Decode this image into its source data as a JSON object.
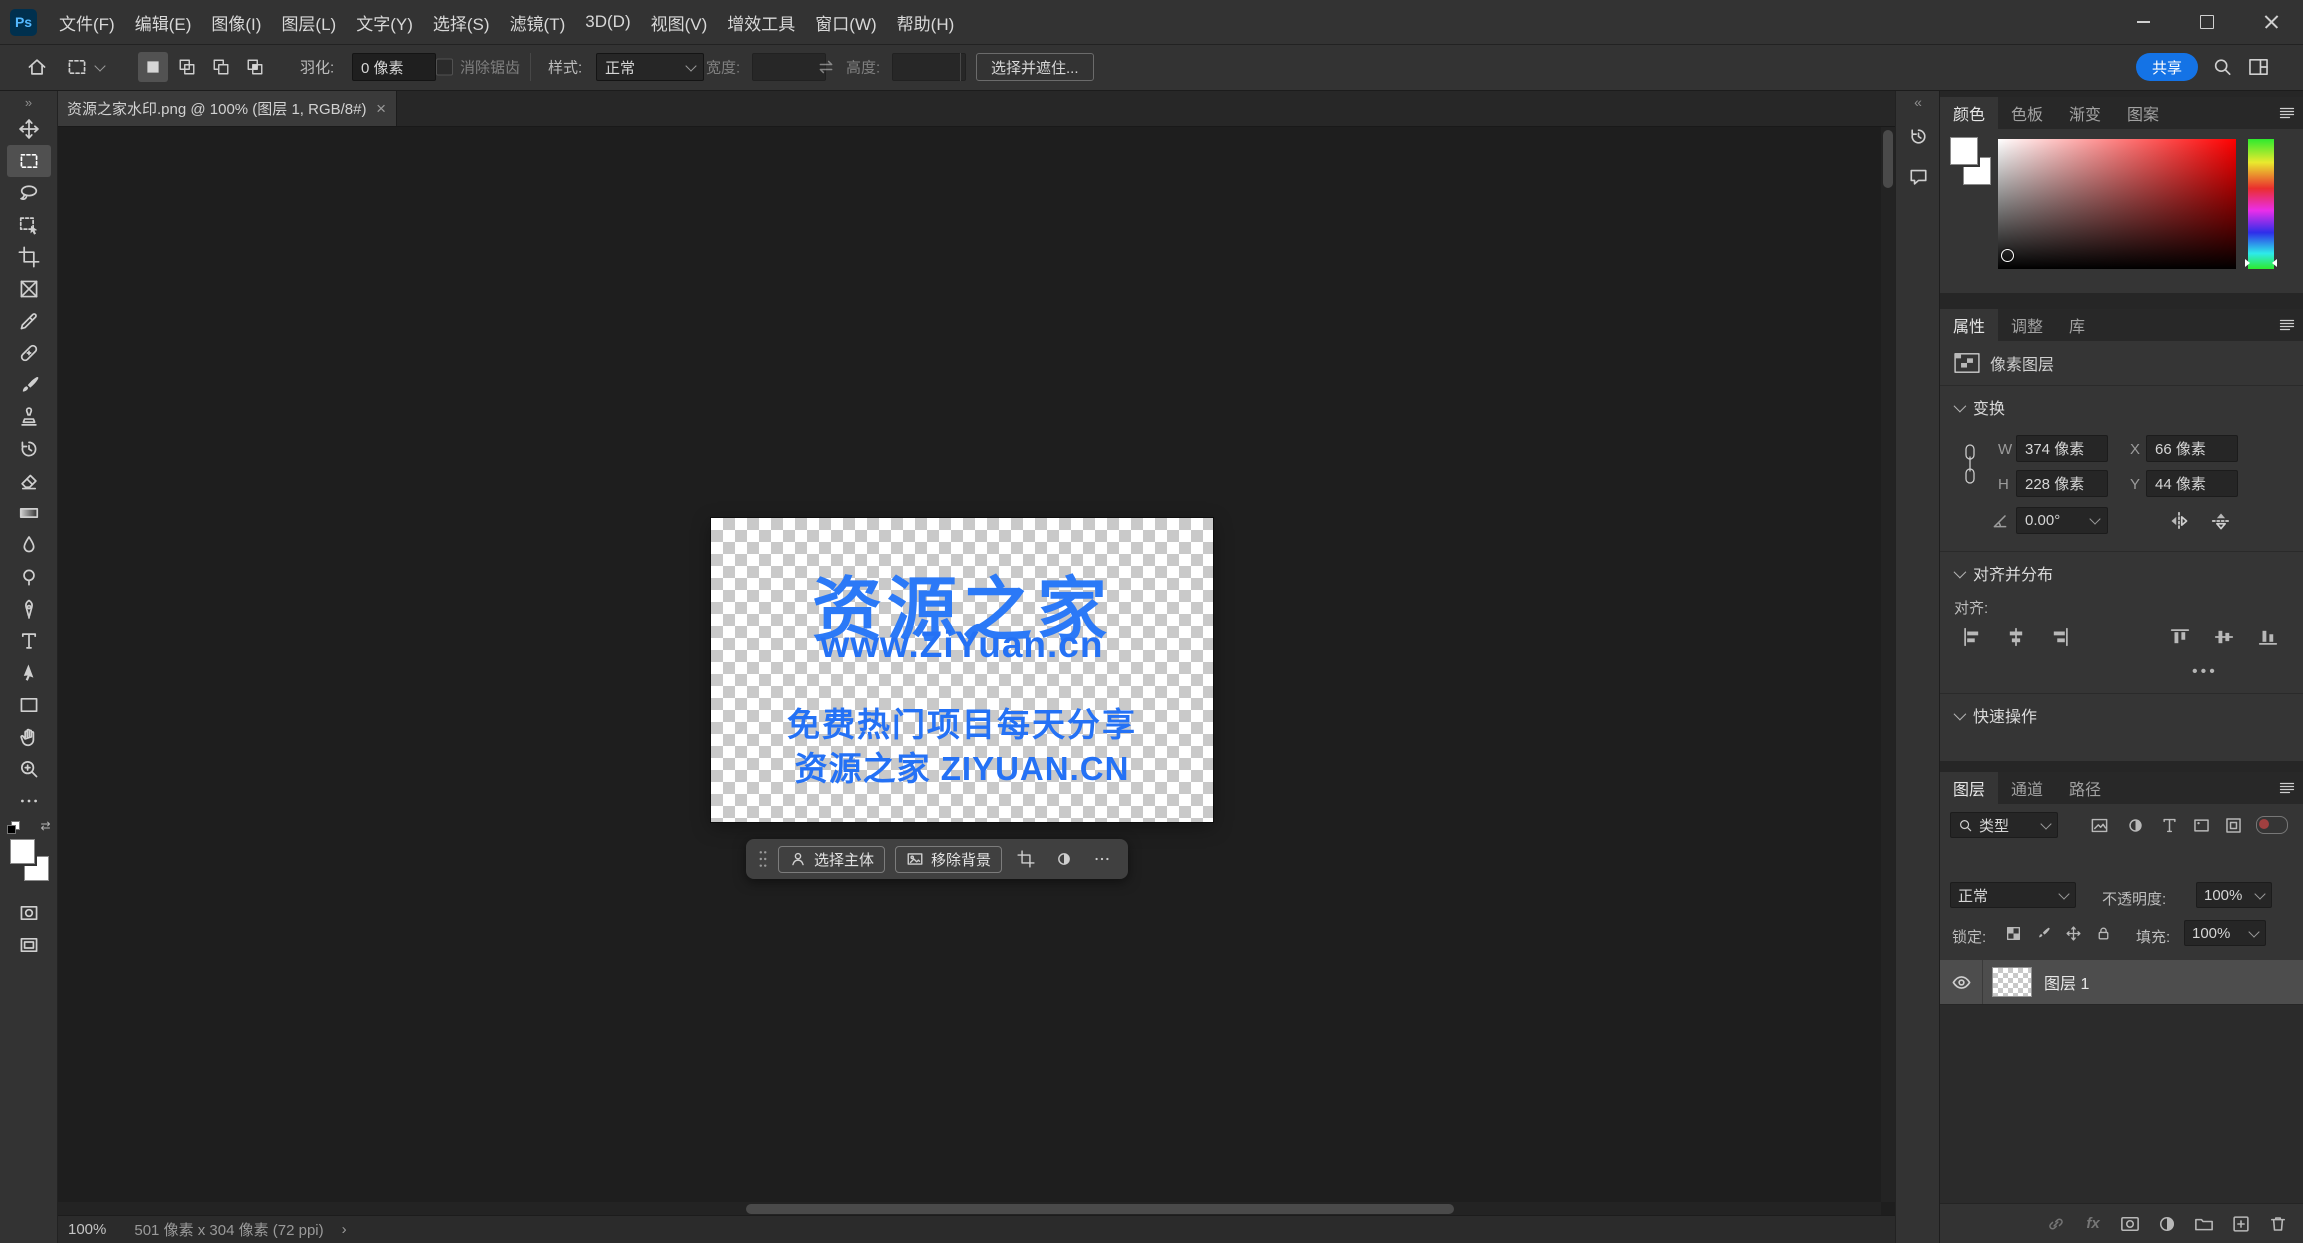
{
  "app": {
    "logo_text": "Ps"
  },
  "menu_bar": {
    "items": [
      "文件(F)",
      "编辑(E)",
      "图像(I)",
      "图层(L)",
      "文字(Y)",
      "选择(S)",
      "滤镜(T)",
      "3D(D)",
      "视图(V)",
      "增效工具",
      "窗口(W)",
      "帮助(H)"
    ]
  },
  "options_bar": {
    "feather_label": "羽化:",
    "feather_value": "0 像素",
    "antialias_label": "消除锯齿",
    "style_label": "样式:",
    "style_value": "正常",
    "width_label": "宽度:",
    "width_value": "",
    "height_label": "高度:",
    "height_value": "",
    "select_and_mask_label": "选择并遮住...",
    "share_label": "共享"
  },
  "document_tab": {
    "title": "资源之家水印.png @ 100% (图层 1, RGB/8#)",
    "close_glyph": "×"
  },
  "toolbar": {
    "collapse_glyph": "»",
    "tools": [
      "move-tool",
      "rectangular-marquee-tool",
      "lasso-tool",
      "object-selection-tool",
      "crop-tool",
      "frame-tool",
      "eyedropper-tool",
      "spot-healing-brush-tool",
      "brush-tool",
      "clone-stamp-tool",
      "history-brush-tool",
      "eraser-tool",
      "gradient-tool",
      "blur-tool",
      "dodge-tool",
      "pen-tool",
      "type-tool",
      "path-selection-tool",
      "rectangle-tool",
      "hand-tool",
      "zoom-tool",
      "edit-toolbar"
    ]
  },
  "canvas": {
    "watermark": {
      "line1": "资源之家",
      "line2": "www.ZiYuan.cn",
      "line3": "免费热门项目每天分享",
      "line4": "资源之家 ZIYUAN.CN"
    },
    "task_bar": {
      "select_subject_label": "选择主体",
      "remove_background_label": "移除背景"
    }
  },
  "status_bar": {
    "zoom": "100%",
    "doc_info": "501 像素 x 304 像素 (72 ppi)",
    "expand_glyph": "›"
  },
  "side_strip": {
    "collapse_glyph": "«"
  },
  "panels": {
    "color": {
      "tabs": [
        "颜色",
        "色板",
        "渐变",
        "图案"
      ]
    },
    "properties": {
      "tabs": [
        "属性",
        "调整",
        "库"
      ],
      "layer_type_label": "像素图层",
      "transform_title": "变换",
      "w_label": "W",
      "w_value": "374 像素",
      "x_label": "X",
      "x_value": "66 像素",
      "h_label": "H",
      "h_value": "228 像素",
      "y_label": "Y",
      "y_value": "44 像素",
      "angle_value": "0.00°",
      "align_title": "对齐并分布",
      "align_label": "对齐:",
      "more_glyph": "•••",
      "quick_actions_title": "快速操作"
    },
    "layers": {
      "tabs": [
        "图层",
        "通道",
        "路径"
      ],
      "filter_label": "类型",
      "blend_mode": "正常",
      "opacity_label": "不透明度:",
      "opacity_value": "100%",
      "lock_label": "锁定:",
      "fill_label": "填充:",
      "fill_value": "100%",
      "fx_label": "fx",
      "layer_rows": [
        {
          "name": "图层 1"
        }
      ]
    }
  }
}
